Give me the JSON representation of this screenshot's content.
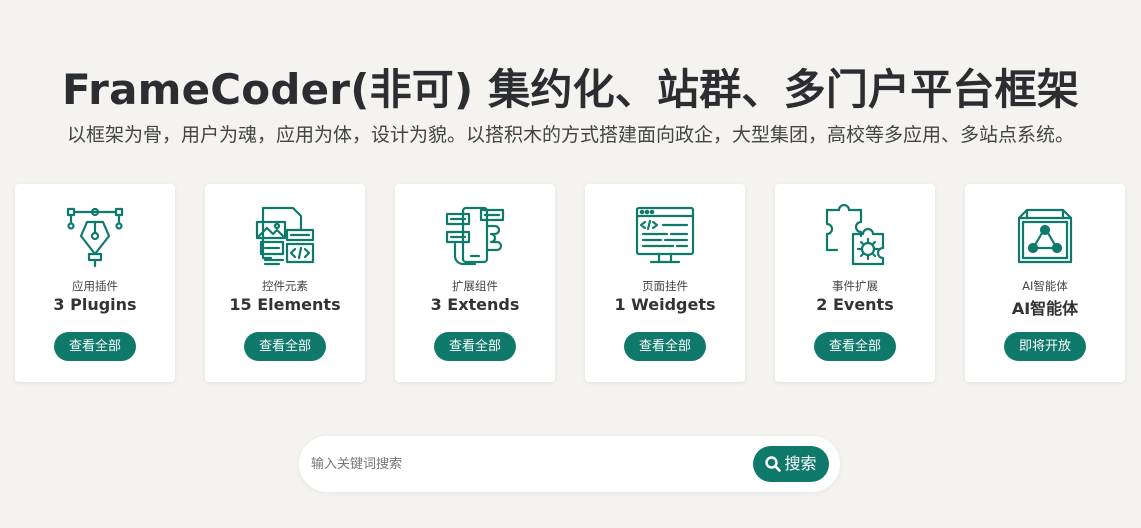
{
  "hero": {
    "title": "FrameCoder(非可) 集约化、站群、多门户平台框架",
    "subtitle": "以框架为骨，用户为魂，应用为体，设计为貌。以搭积木的方式搭建面向政企，大型集团，高校等多应用、多站点系统。"
  },
  "cards": [
    {
      "category": "应用插件",
      "count": "3 Plugins",
      "button": "查看全部",
      "icon": "pen-tool-icon"
    },
    {
      "category": "控件元素",
      "count": "15 Elements",
      "button": "查看全部",
      "icon": "widgets-icon"
    },
    {
      "category": "扩展组件",
      "count": "3 Extends",
      "button": "查看全部",
      "icon": "phone-extend-icon"
    },
    {
      "category": "页面挂件",
      "count": "1 Weidgets",
      "button": "查看全部",
      "icon": "code-window-icon"
    },
    {
      "category": "事件扩展",
      "count": "2 Events",
      "button": "查看全部",
      "icon": "puzzle-gear-icon"
    },
    {
      "category": "AI智能体",
      "count": "AI智能体",
      "button": "即将开放",
      "icon": "ai-cube-icon"
    }
  ],
  "search": {
    "placeholder": "输入关键词搜索",
    "value": "",
    "button": "搜索"
  },
  "colors": {
    "accent": "#0f7a6b",
    "background": "#f4f3f0",
    "card": "#ffffff"
  }
}
